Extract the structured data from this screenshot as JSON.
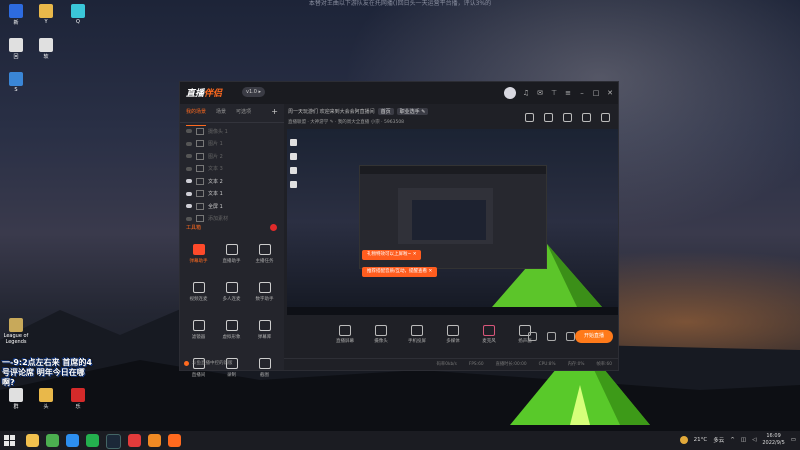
{
  "desktop": {
    "notice": "本替对王曲以下游队友在托网播()回日头一天运营平台播，评认3%的",
    "icons_top": [
      {
        "label": "新",
        "color": "#2d6be0"
      },
      {
        "label": "Y",
        "color": "#e9b84a"
      },
      {
        "label": "Q",
        "color": "#3ac7d9"
      }
    ],
    "icons_mid": [
      {
        "label": "回",
        "color": "#e0e0e0"
      },
      {
        "label": "软",
        "color": "#e0e0e0"
      },
      {
        "label": "S",
        "color": "#3a86d6"
      }
    ],
    "league_label": "League of Legends",
    "stream_overlay": "一-9:2点左右来 首席的4号评论席 明年今日在哪啊?",
    "icons_bottom": [
      {
        "label": "群",
        "color": "#e0e0e0"
      },
      {
        "label": "头",
        "color": "#e9b84a"
      },
      {
        "label": "乐",
        "color": "#d42a2a"
      }
    ]
  },
  "window": {
    "logo_main": "直播",
    "logo_accent": "伴侣",
    "version": "v1.0 ▸",
    "tabs": [
      "我的场景",
      "场景",
      "可选项"
    ],
    "tab_plus": "+",
    "scenes": [
      {
        "label": "摄像头 1",
        "on": false
      },
      {
        "label": "图片 1",
        "on": false
      },
      {
        "label": "图片 2",
        "on": false
      },
      {
        "label": "文本 3",
        "on": false
      },
      {
        "label": "文本 2",
        "on": true
      },
      {
        "label": "文本 1",
        "on": true
      },
      {
        "label": "全屏 1",
        "on": true
      },
      {
        "label": "添加素材",
        "on": false
      }
    ],
    "toolbox_title": "工具箱",
    "tools": [
      "弹幕助手",
      "直播助手",
      "主播任务",
      "视频连麦",
      "多人连麦",
      "数字助手",
      "滤镜器",
      "虚拟形象",
      "弹幕库",
      "直播间",
      "录制",
      "截图"
    ],
    "footer_note": "斗鱼直播中控的新版",
    "info_line": "周一天玩游们 欢迎来到大会会阿直播间",
    "info_tag1": "首页",
    "info_tag2": "职业选手 ✎",
    "info_line2": "直播联盟 · 大神游学 ✎  · 我的周大全直播 小宗 · 5963508",
    "tip1": "礼物特效可以上屏啦~  ✕",
    "tip2": "推荐搭配音质/互动，提醒查看  ✕",
    "bottom_tools": [
      "直播屏幕",
      "摄像头",
      "手机投屏",
      "多媒体",
      "麦克风",
      "扬声器"
    ],
    "live_button": "开始直播",
    "status": [
      "码率0kb/s",
      "FPS:60",
      "直播时长:00:00",
      "CPU:8%",
      "内存:0%",
      "帧率:60"
    ]
  },
  "taskbar": {
    "apps": [
      {
        "name": "folder",
        "color": "#f2c14e"
      },
      {
        "name": "chrome",
        "color": "#4caf50"
      },
      {
        "name": "edge",
        "color": "#2d8ff0"
      },
      {
        "name": "app-green",
        "color": "#24b04e"
      },
      {
        "name": "steam",
        "color": "#1b2838"
      },
      {
        "name": "app-red",
        "color": "#e23b3b"
      },
      {
        "name": "app-orange",
        "color": "#f08a24"
      },
      {
        "name": "app-live",
        "color": "#ff6a1f"
      }
    ],
    "temperature": "21°C",
    "weather": "多云",
    "time": "16:09",
    "date": "2022/9/5"
  }
}
